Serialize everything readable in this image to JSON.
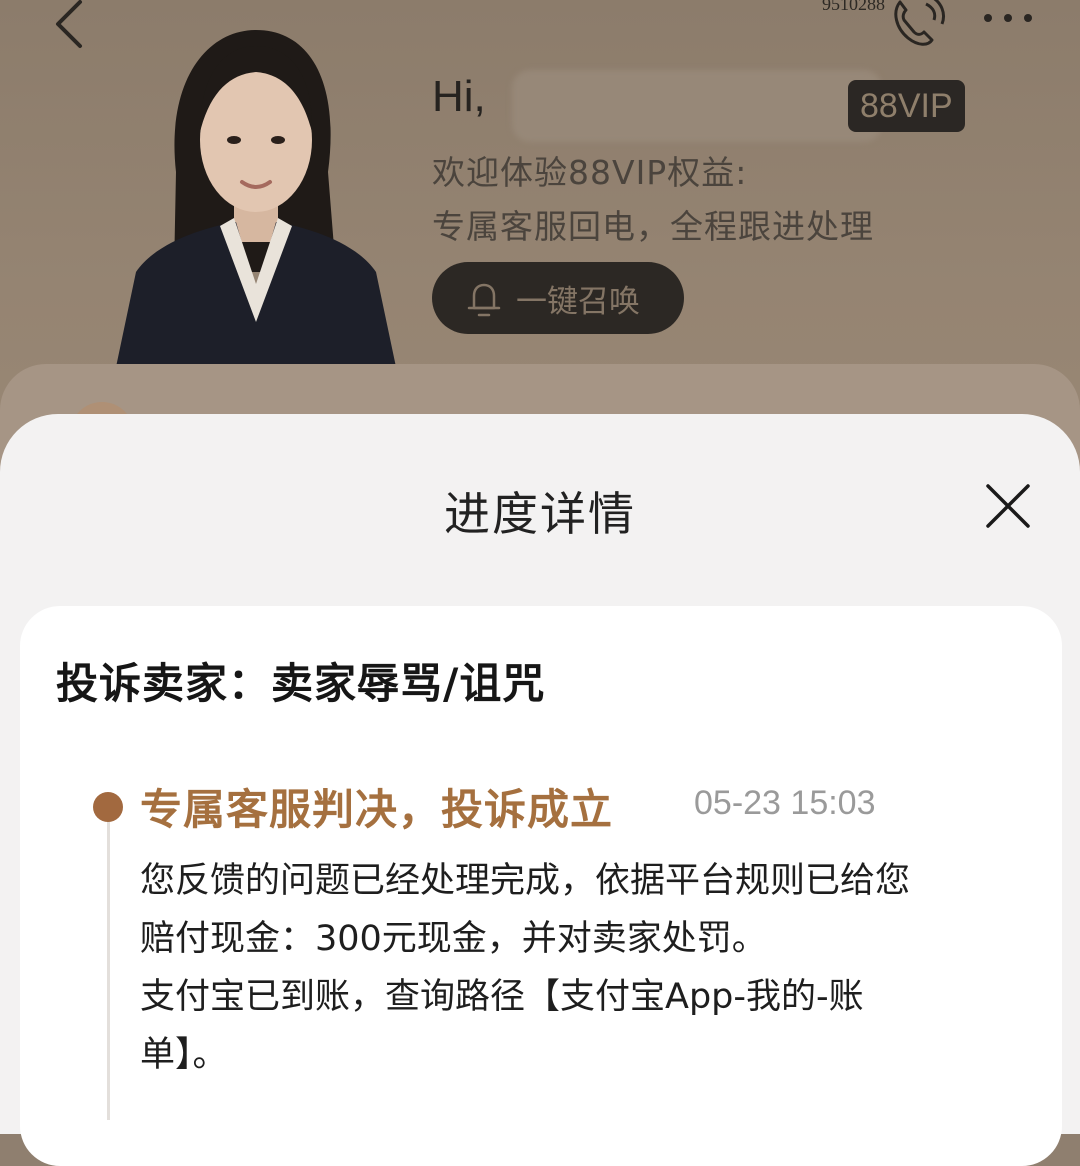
{
  "header": {
    "phone_number": "9510288",
    "greeting_prefix": "Hi,",
    "vip_badge": "88VIP",
    "welcome_line_1": "欢迎体验88VIP权益:",
    "welcome_line_2": "专属客服回电，全程跟进处理",
    "summon_button": "一键召唤"
  },
  "modal": {
    "title": "进度详情"
  },
  "complaint": {
    "title": "投诉卖家：卖家辱骂/诅咒",
    "timeline": [
      {
        "status": "专属客服判决，投诉成立",
        "time": "05-23 15:03",
        "lines": [
          "您反馈的问题已经处理完成，依据平台规则已给您",
          "赔付现金：300元现金，并对卖家处罚。",
          "支付宝已到账，查询路径【支付宝App-我的-账",
          "单】。"
        ]
      }
    ]
  },
  "colors": {
    "accent": "#a5703f",
    "dimmed_background": "#8f7f6f",
    "vip_badge_bg": "#2b2724"
  },
  "icons": [
    "back-arrow-icon",
    "phone-icon",
    "more-icon",
    "bell-icon",
    "close-icon"
  ]
}
